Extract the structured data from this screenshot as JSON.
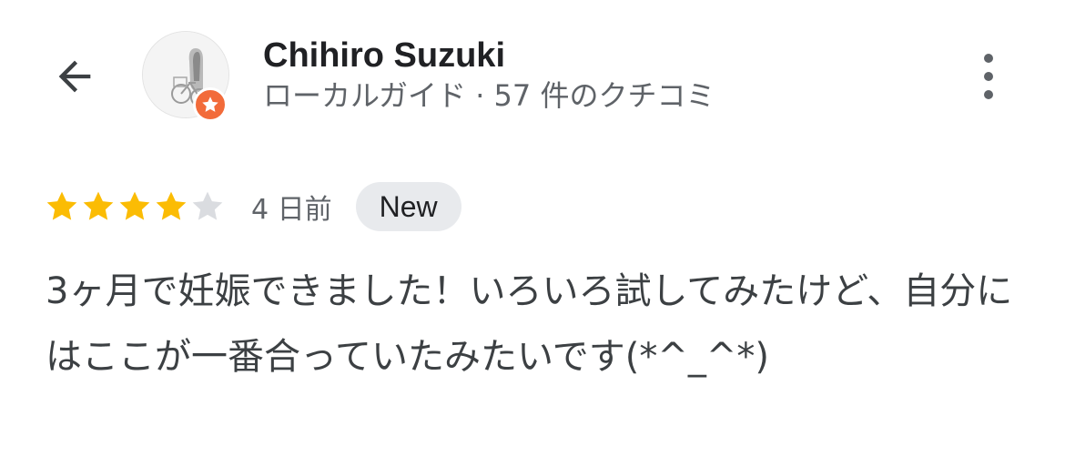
{
  "header": {
    "back_icon": "arrow-left-icon",
    "user_name": "Chihiro Suzuki",
    "user_meta": "ローカルガイド · 57 件のクチコミ",
    "badge_icon": "local-guide-star-icon",
    "badge_color": "#f26b3a",
    "menu_icon": "more-vert-icon"
  },
  "review": {
    "rating": 4,
    "max_rating": 5,
    "star_color": "#fbbc04",
    "star_empty_color": "#dadce0",
    "date": "4 日前",
    "badge": "New",
    "text": "3ヶ月で妊娠できました！いろいろ試してみたけど、自分にはここが一番合っていたみたいです(*^_^*)"
  }
}
